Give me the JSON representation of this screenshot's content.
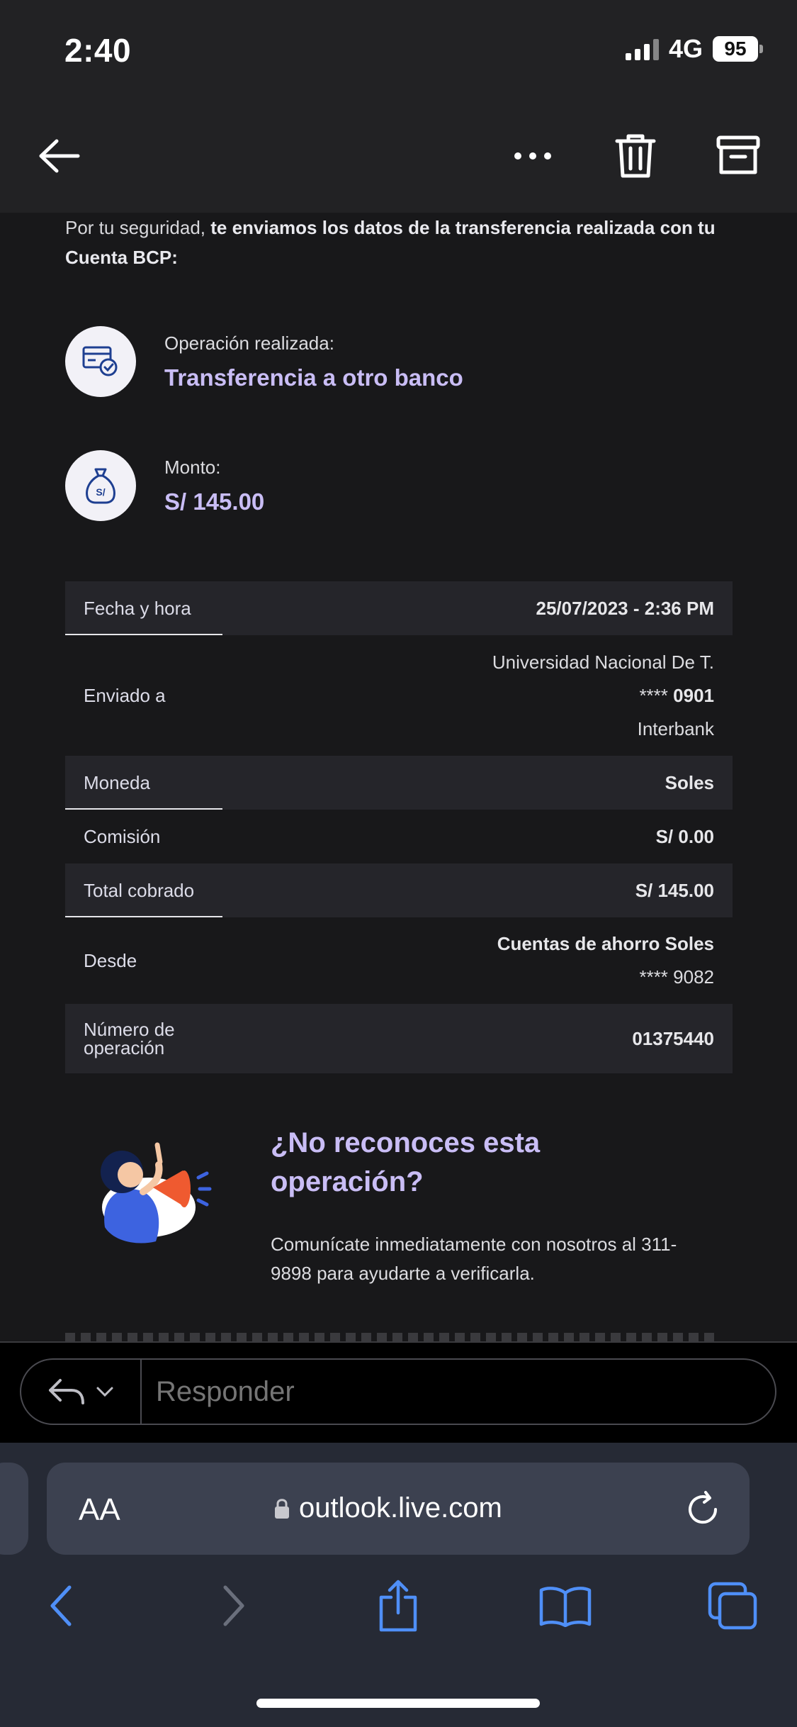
{
  "status_bar": {
    "time": "2:40",
    "network": "4G",
    "battery": "95"
  },
  "toolbar": {
    "back": "back-arrow-icon",
    "more": "more-icon",
    "delete": "trash-icon",
    "archive": "archive-icon"
  },
  "email": {
    "intro_plain": "Por tu seguridad, ",
    "intro_bold": "te enviamos los datos de la transferencia realizada con tu Cuenta BCP:",
    "operation": {
      "label": "Operación realizada:",
      "value": "Transferencia a otro banco"
    },
    "amount": {
      "label": "Monto:",
      "value": "S/ 145.00"
    },
    "details": {
      "fecha_label": "Fecha y hora",
      "fecha_value": "25/07/2023 - 2:36 PM",
      "enviado_label": "Enviado a",
      "enviado_name": "Universidad Nacional De T.",
      "enviado_account_mask": "****",
      "enviado_account_num": "0901",
      "enviado_bank": "Interbank",
      "moneda_label": "Moneda",
      "moneda_value": "Soles",
      "comision_label": "Comisión",
      "comision_value": "S/ 0.00",
      "total_label": "Total cobrado",
      "total_value": "S/ 145.00",
      "desde_label": "Desde",
      "desde_account_type": "Cuentas de ahorro Soles",
      "desde_account": "**** 9082",
      "numero_label_1": "Número de",
      "numero_label_2": "operación",
      "numero_value": "01375440"
    },
    "warning": {
      "title": "¿No reconoces esta operación?",
      "desc": "Comunícate inmediatamente con nosotros al 311-9898 para ayudarte a verificarla."
    }
  },
  "reply": {
    "placeholder": "Responder"
  },
  "browser": {
    "aa": "AA",
    "url": "outlook.live.com"
  },
  "colors": {
    "accent": "#c9bdf5",
    "ios_blue": "#4f8ff7"
  }
}
